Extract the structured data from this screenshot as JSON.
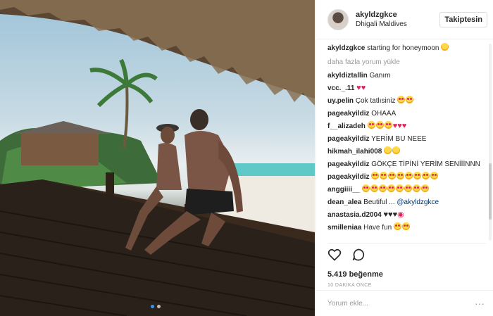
{
  "post": {
    "username": "akyldzgkce",
    "location": "Dhigali Maldives",
    "follow_label": "Takiptesin",
    "caption": "starting for honeymoon",
    "load_more": "daha fazla yorum yükle",
    "likes": "5.419 beğenme",
    "time": "10 DAKİKA ÖNCE",
    "comment_placeholder": "Yorum ekle...",
    "more_label": "···",
    "photo_index": 1,
    "photo_count": 2
  },
  "comments": [
    {
      "user": "akyldiztallin",
      "text": "Ganım",
      "icons": []
    },
    {
      "user": "vcc._.11",
      "text": "",
      "icons": [
        "red-heart",
        "red-heart"
      ]
    },
    {
      "user": "uy.pelin",
      "text": "Çok tatlısiniz",
      "icons": [
        "heart-eyes",
        "heart-eyes"
      ]
    },
    {
      "user": "pageakyildiz",
      "text": "OHAAA",
      "icons": []
    },
    {
      "user": "f__alizadeh",
      "text": "",
      "icons": [
        "heart-eyes",
        "heart-eyes",
        "heart-eyes",
        "red-heart",
        "red-heart",
        "red-heart"
      ]
    },
    {
      "user": "pageakyildiz",
      "text": "YERİM BU NEEE",
      "icons": []
    },
    {
      "user": "hikmah_ilahi008",
      "text": "",
      "icons": [
        "smile",
        "smile"
      ]
    },
    {
      "user": "pageakyildiz",
      "text": "GÖKÇE TİPİNİ YERİM SENİİİNNN",
      "icons": []
    },
    {
      "user": "pageakyildiz",
      "text": "",
      "icons": [
        "heart-eyes",
        "heart-eyes",
        "heart-eyes",
        "heart-eyes",
        "heart-eyes",
        "heart-eyes",
        "heart-eyes",
        "heart-eyes"
      ]
    },
    {
      "user": "anggiiii__",
      "text": "",
      "icons": [
        "heart-eyes",
        "heart-eyes",
        "heart-eyes",
        "heart-eyes",
        "heart-eyes",
        "heart-eyes",
        "heart-eyes",
        "heart-eyes"
      ]
    },
    {
      "user": "dean_alea",
      "text": "Beutiful ... @akyldzgkce",
      "icons": []
    },
    {
      "user": "anastasia.d2004",
      "text": "",
      "icons": [
        "black-heart",
        "black-heart",
        "black-heart",
        "lips"
      ]
    },
    {
      "user": "smilleniaa",
      "text": "Have fun",
      "icons": [
        "heart-eyes",
        "heart-eyes"
      ]
    }
  ],
  "colors": {
    "accent": "#3897f0",
    "heart": "#e0245e",
    "muted": "#999999",
    "text": "#262626"
  }
}
